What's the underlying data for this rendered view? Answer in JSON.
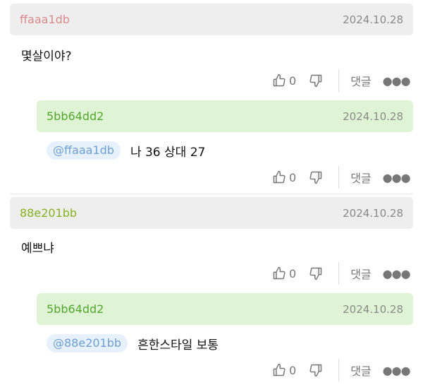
{
  "comments": [
    {
      "author": "ffaaa1db",
      "date": "2024.10.28",
      "text": "몇살이야?",
      "likes": "0",
      "reply_label": "댓글",
      "replies": [
        {
          "author": "5bb64dd2",
          "date": "2024.10.28",
          "mention": "@ffaaa1db",
          "text": "나 36 상대 27",
          "likes": "0",
          "reply_label": "댓글"
        }
      ]
    },
    {
      "author": "88e201bb",
      "date": "2024.10.28",
      "text": "예쁘냐",
      "likes": "0",
      "reply_label": "댓글",
      "replies": [
        {
          "author": "5bb64dd2",
          "date": "2024.10.28",
          "mention": "@88e201bb",
          "text": "흔한스타일 보통",
          "likes": "0",
          "reply_label": "댓글"
        }
      ]
    }
  ],
  "colors": {
    "header_gray": "#eeeeee",
    "header_green": "#dff4d4",
    "author_pink": "#d98b8b",
    "author_green": "#53a72f",
    "author_lime": "#86b11f",
    "mention_text": "#6e9fd0",
    "mention_bg": "#e7f1fb"
  },
  "icons": [
    "thumbs-up-icon",
    "thumbs-down-icon",
    "more-dots-icon"
  ]
}
